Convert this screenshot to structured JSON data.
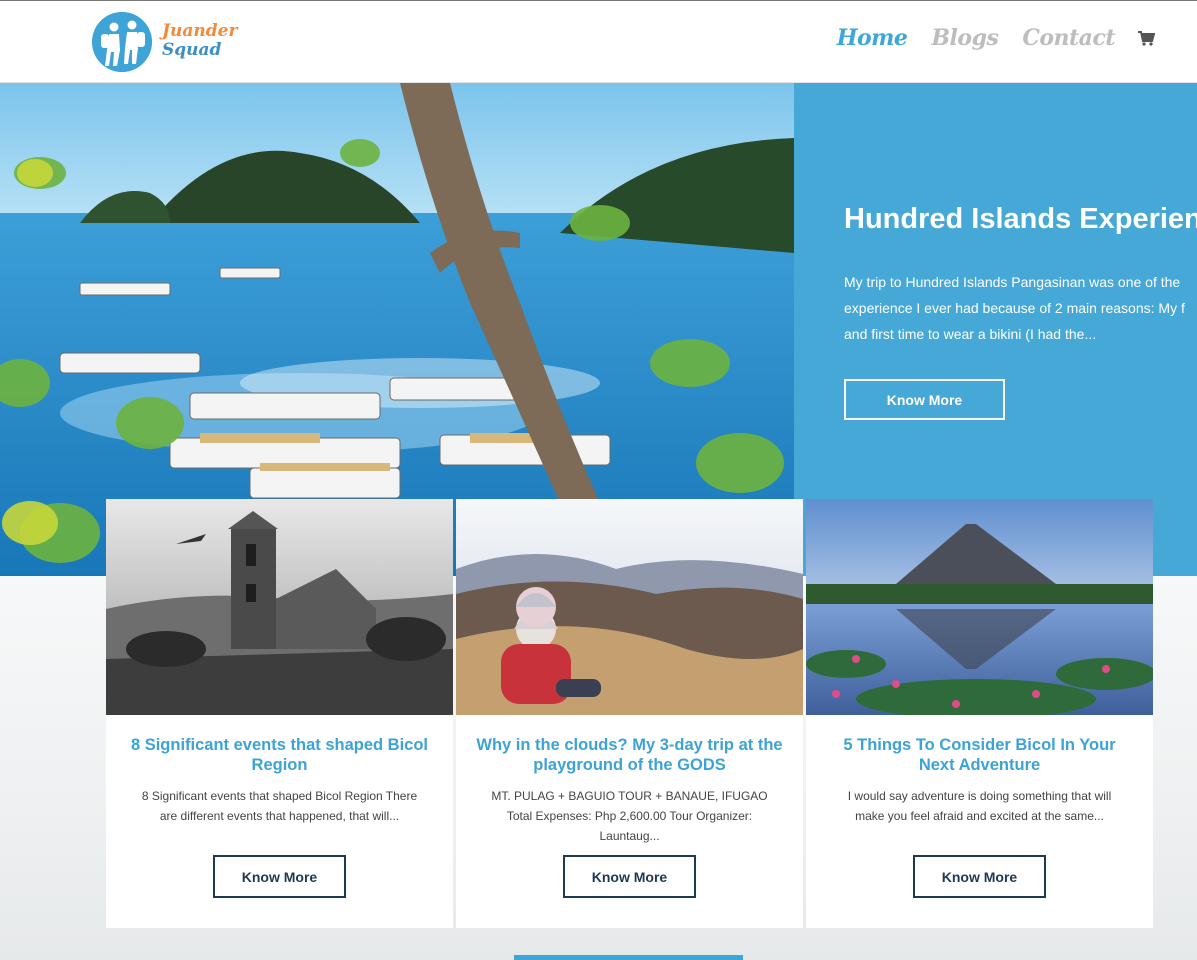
{
  "header": {
    "logo": {
      "line1": "Juander",
      "line2": "Squad"
    },
    "nav": [
      {
        "label": "Home",
        "active": true
      },
      {
        "label": "Blogs",
        "active": false
      },
      {
        "label": "Contact",
        "active": false
      }
    ],
    "cart_icon": "cart-icon"
  },
  "hero": {
    "title": "Hundred Islands Experience",
    "excerpt_lines": [
      "My trip to Hundred Islands Pangasinan was one of the",
      "experience I ever had because of 2 main reasons: My f",
      "and first time to wear a bikini (I had the..."
    ],
    "button": "Know More"
  },
  "cards": [
    {
      "title": "8 Significant events that shaped Bicol Region",
      "excerpt": "8 Significant events that shaped Bicol Region There are different events that happened, that will...",
      "button": "Know More"
    },
    {
      "title": "Why in the clouds? My 3-day trip at the playground of the GODS",
      "excerpt": "MT. PULAG + BAGUIO TOUR + BANAUE, IFUGAO Total Expenses: Php 2,600.00 Tour Organizer: Launtaug...",
      "button": "Know More"
    },
    {
      "title": "5 Things To Consider Bicol In Your Next Adventure",
      "excerpt": "I would say adventure is doing something that will make you feel afraid and excited at the same...",
      "button": "Know More"
    }
  ],
  "colors": {
    "accent": "#3da7d9",
    "hero_panel": "#45a8d6",
    "button_dark": "#1e3a52",
    "logo_orange": "#f28a3a"
  }
}
